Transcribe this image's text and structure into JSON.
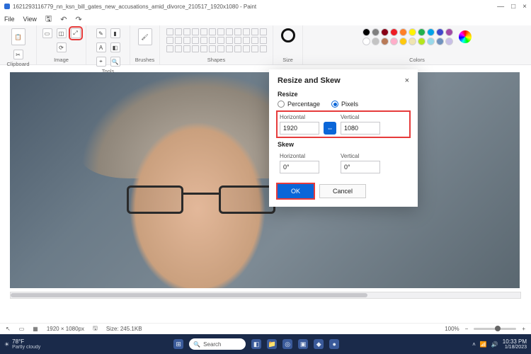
{
  "titlebar": {
    "title": "1621293116779_nn_ksn_bill_gates_new_accusations_amid_divorce_210517_1920x1080 - Paint"
  },
  "win_controls": {
    "min": "—",
    "max": "□",
    "close": "×"
  },
  "menubar": {
    "file": "File",
    "view": "View"
  },
  "ribbon": {
    "clipboard": "Clipboard",
    "image": "Image",
    "tools": "Tools",
    "brushes": "Brushes",
    "shapes": "Shapes",
    "size": "Size",
    "colors": "Colors"
  },
  "colors": {
    "row1": [
      "#000000",
      "#7f7f7f",
      "#880015",
      "#ed1c24",
      "#ff7f27",
      "#fff200",
      "#22b14c",
      "#00a2e8",
      "#3f48cc",
      "#a349a4"
    ],
    "row2": [
      "#ffffff",
      "#c3c3c3",
      "#b97a57",
      "#ffaec9",
      "#ffc90e",
      "#efe4b0",
      "#b5e61d",
      "#99d9ea",
      "#7092be",
      "#c8bfe7"
    ]
  },
  "statusbar": {
    "dimensions": "1920 × 1080px",
    "filesize": "Size: 245.1KB",
    "zoom": "100%"
  },
  "taskbar": {
    "temp": "78°F",
    "weather": "Partly cloudy",
    "search": "Search",
    "time": "10:33 PM",
    "date": "1/18/2023"
  },
  "dialog": {
    "title": "Resize and Skew",
    "resize_label": "Resize",
    "percentage": "Percentage",
    "pixels": "Pixels",
    "horizontal": "Horizontal",
    "vertical": "Vertical",
    "h_val": "1920",
    "v_val": "1080",
    "skew_label": "Skew",
    "skew_h": "0°",
    "skew_v": "0°",
    "ok": "OK",
    "cancel": "Cancel",
    "lock": "⇔"
  }
}
